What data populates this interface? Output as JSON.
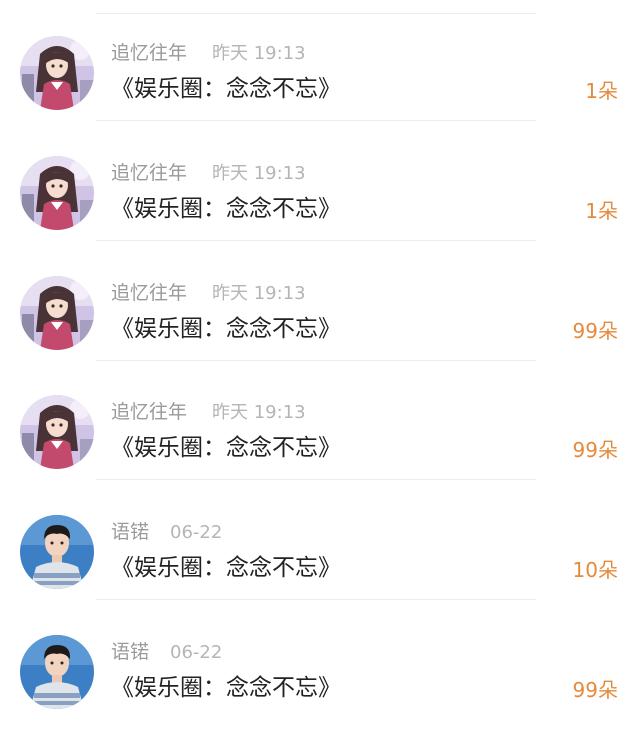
{
  "accent_color": "#e58a3c",
  "items": [
    {
      "name": "追忆往年",
      "time": "昨天 19:13",
      "title": "《娱乐圈：念念不忘》",
      "count": "1朵",
      "avatar_icon": "anime-girl-avatar-icon"
    },
    {
      "name": "追忆往年",
      "time": "昨天 19:13",
      "title": "《娱乐圈：念念不忘》",
      "count": "1朵",
      "avatar_icon": "anime-girl-avatar-icon"
    },
    {
      "name": "追忆往年",
      "time": "昨天 19:13",
      "title": "《娱乐圈：念念不忘》",
      "count": "99朵",
      "avatar_icon": "anime-girl-avatar-icon"
    },
    {
      "name": "追忆往年",
      "time": "昨天 19:13",
      "title": "《娱乐圈：念念不忘》",
      "count": "99朵",
      "avatar_icon": "anime-girl-avatar-icon"
    },
    {
      "name": "语锘",
      "time": "06-22",
      "title": "《娱乐圈：念念不忘》",
      "count": "10朵",
      "avatar_icon": "young-man-avatar-icon"
    },
    {
      "name": "语锘",
      "time": "06-22",
      "title": "《娱乐圈：念念不忘》",
      "count": "99朵",
      "avatar_icon": "young-man-avatar-icon"
    }
  ]
}
